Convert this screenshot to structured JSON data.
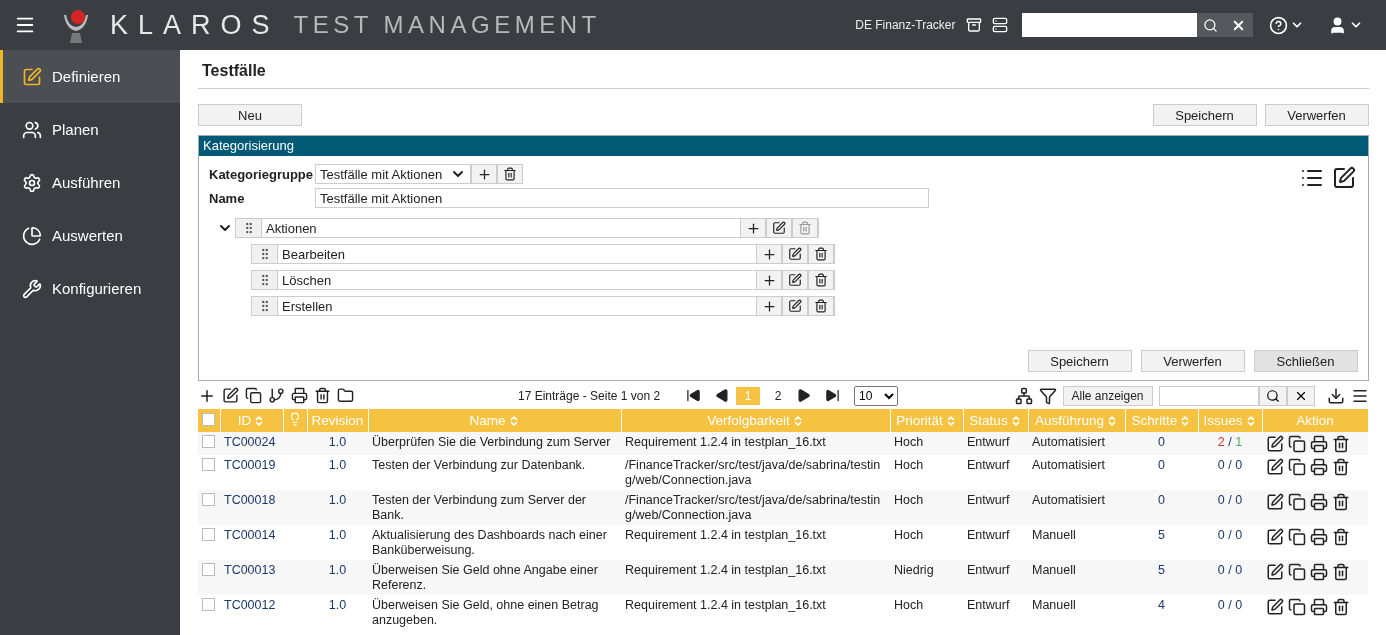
{
  "header": {
    "logo_word": "KLAROS",
    "logo_suffix": "TEST MANAGEMENT",
    "project": "DE Finanz-Tracker"
  },
  "sidebar": {
    "items": [
      {
        "label": "Definieren",
        "kind": "edit",
        "selected": true
      },
      {
        "label": "Planen",
        "kind": "users",
        "selected": false
      },
      {
        "label": "Ausführen",
        "kind": "cog",
        "selected": false
      },
      {
        "label": "Auswerten",
        "kind": "chart",
        "selected": false
      },
      {
        "label": "Konfigurieren",
        "kind": "wrench",
        "selected": false
      }
    ]
  },
  "page": {
    "title": "Testfälle",
    "new_button": "Neu",
    "save_button": "Speichern",
    "discard_button": "Verwerfen"
  },
  "categorization": {
    "title": "Kategorisierung",
    "group_label": "Kategoriegruppe",
    "group_value": "Testfälle mit Aktionen",
    "name_label": "Name",
    "name_value": "Testfälle mit Aktionen",
    "tree": [
      {
        "label": "Aktionen",
        "expanded": true,
        "delete_disabled": true,
        "children": [
          {
            "label": "Bearbeiten",
            "delete_disabled": false
          },
          {
            "label": "Löschen",
            "delete_disabled": false
          },
          {
            "label": "Erstellen",
            "delete_disabled": false
          }
        ]
      }
    ],
    "buttons": [
      {
        "label": "Speichern",
        "primary": false
      },
      {
        "label": "Verwerfen",
        "primary": false
      },
      {
        "label": "Schließen",
        "primary": true
      }
    ]
  },
  "table": {
    "select_all_checked": false,
    "summary": "17 Einträge - Seite 1 von 2",
    "pages": [
      {
        "label": "1",
        "selected": true
      },
      {
        "label": "2",
        "selected": false
      }
    ],
    "page_size": "10",
    "show_all": "Alle anzeigen",
    "columns": [
      {
        "kind": "checkbox"
      },
      {
        "kind": "text",
        "label": "ID",
        "sortable": true
      },
      {
        "kind": "icon"
      },
      {
        "kind": "text",
        "label": "Revision",
        "sortable": false
      },
      {
        "kind": "text",
        "label": "Name",
        "sortable": true
      },
      {
        "kind": "text",
        "label": "Verfolgbarkeit",
        "sortable": true
      },
      {
        "kind": "text",
        "label": "Priorität",
        "sortable": true
      },
      {
        "kind": "text",
        "label": "Status",
        "sortable": true
      },
      {
        "kind": "text",
        "label": "Ausführung",
        "sortable": true
      },
      {
        "kind": "text",
        "label": "Schritte",
        "sortable": true
      },
      {
        "kind": "text",
        "label": "Issues",
        "sortable": true
      },
      {
        "kind": "text",
        "label": "Aktion",
        "sortable": false
      }
    ],
    "rows": [
      {
        "checked": false,
        "id": "TC00024",
        "revision": "1.0",
        "name": "Überprüfen Sie die Verbindung zum Server",
        "traceability": "Requirement 1.2.4 in testplan_16.txt",
        "priority": "Hoch",
        "status": "Entwurf",
        "execution": "Automatisiert",
        "steps": "0",
        "issues": {
          "open": "2",
          "separator": "/",
          "closed": "1",
          "highlight": true
        }
      },
      {
        "checked": false,
        "id": "TC00019",
        "revision": "1.0",
        "name": "Testen der Verbindung zur Datenbank.",
        "traceability": "/FinanceTracker/src/test/java/de/sabrina/testing/web/Connection.java",
        "priority": "Hoch",
        "status": "Entwurf",
        "execution": "Automatisiert",
        "steps": "0",
        "issues": {
          "open": "0",
          "separator": "/",
          "closed": "0",
          "highlight": false
        }
      },
      {
        "checked": false,
        "id": "TC00018",
        "revision": "1.0",
        "name": "Testen der Verbindung zum Server der Bank.",
        "traceability": "/FinanceTracker/src/test/java/de/sabrina/testing/web/Connection.java",
        "priority": "Hoch",
        "status": "Entwurf",
        "execution": "Automatisiert",
        "steps": "0",
        "issues": {
          "open": "0",
          "separator": "/",
          "closed": "0",
          "highlight": false
        }
      },
      {
        "checked": false,
        "id": "TC00014",
        "revision": "1.0",
        "name": "Aktualisierung des Dashboards nach einer Banküberweisung.",
        "traceability": "Requirement 1.2.4 in testplan_16.txt",
        "priority": "Hoch",
        "status": "Entwurf",
        "execution": "Manuell",
        "steps": "5",
        "issues": {
          "open": "0",
          "separator": "/",
          "closed": "0",
          "highlight": false
        }
      },
      {
        "checked": false,
        "id": "TC00013",
        "revision": "1.0",
        "name": "Überweisen Sie Geld ohne Angabe einer Referenz.",
        "traceability": "Requirement 1.2.4 in testplan_16.txt",
        "priority": "Niedrig",
        "status": "Entwurf",
        "execution": "Manuell",
        "steps": "5",
        "issues": {
          "open": "0",
          "separator": "/",
          "closed": "0",
          "highlight": false
        }
      },
      {
        "checked": false,
        "id": "TC00012",
        "revision": "1.0",
        "name": "Überweisen Sie Geld, ohne einen Betrag anzugeben.",
        "traceability": "Requirement 1.2.4 in testplan_16.txt",
        "priority": "Hoch",
        "status": "Entwurf",
        "execution": "Manuell",
        "steps": "4",
        "issues": {
          "open": "0",
          "separator": "/",
          "closed": "0",
          "highlight": false
        }
      }
    ]
  }
}
